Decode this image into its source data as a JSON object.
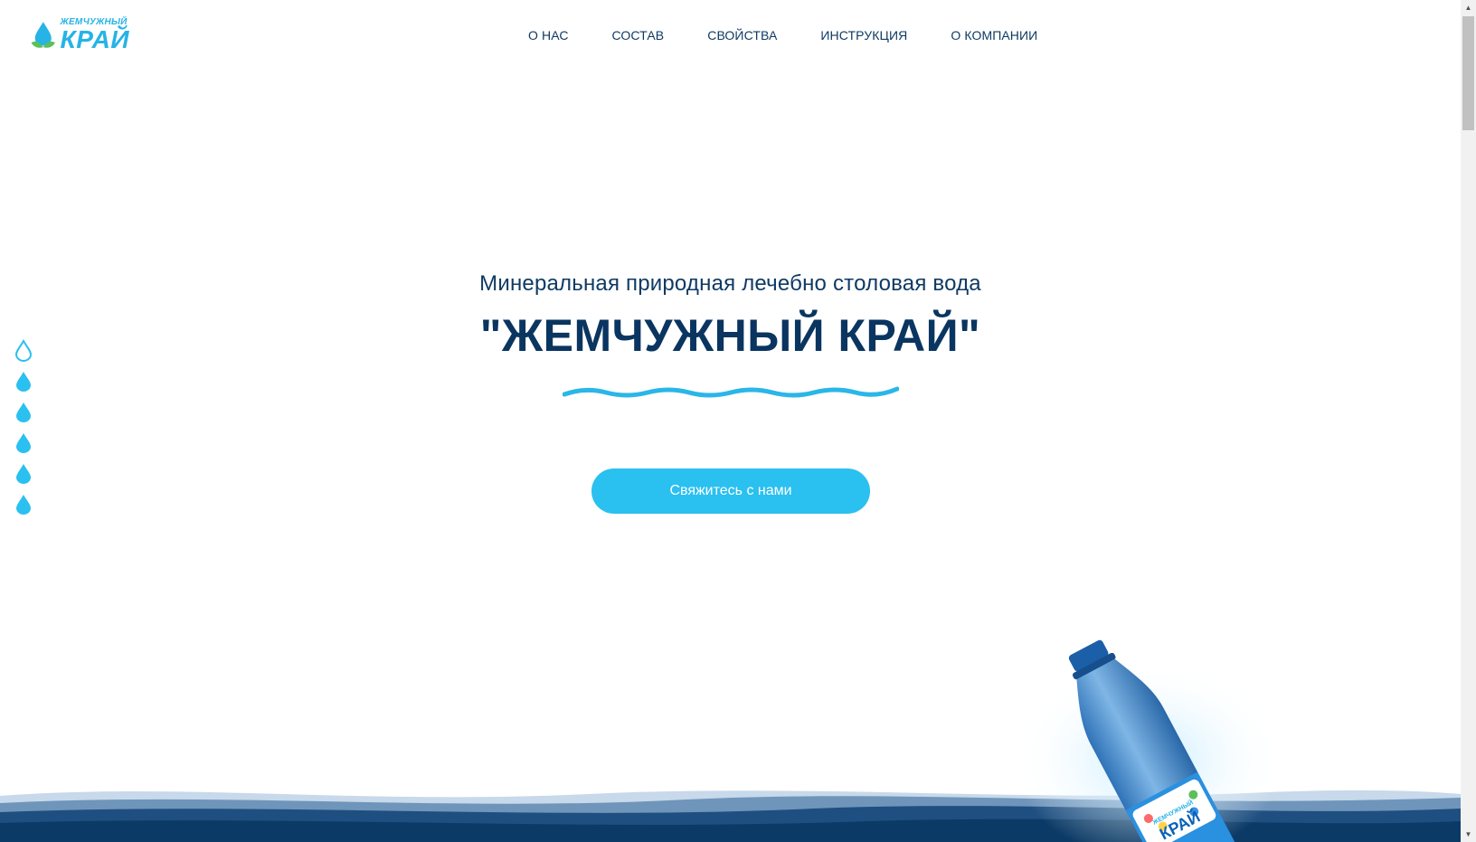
{
  "logo": {
    "small": "ЖЕМЧУЖНЫЙ",
    "big": "КРАЙ"
  },
  "nav": [
    "О НАС",
    "СОСТАВ",
    "СВОЙСТВА",
    "ИНСТРУКЦИЯ",
    "О КОМПАНИИ"
  ],
  "hero": {
    "subtitle": "Минеральная природная лечебно столовая вода",
    "title": "\"ЖЕМЧУЖНЫЙ КРАЙ\"",
    "cta_label": "Свяжитесь с нами"
  },
  "side_nav": {
    "count": 6,
    "active_index": 0
  },
  "bottle_label": {
    "small": "ЖЕМЧУЖНЫЙ",
    "big": "КРАЙ"
  },
  "colors": {
    "accent": "#2ac0f0",
    "navy": "#0a3560",
    "wave_dark": "#0b3a66",
    "logo_blue": "#27b3e6",
    "leaf_green": "#5cc05a"
  },
  "scrollbar": {
    "up_arrow": "▲",
    "down_arrow": "▼"
  }
}
